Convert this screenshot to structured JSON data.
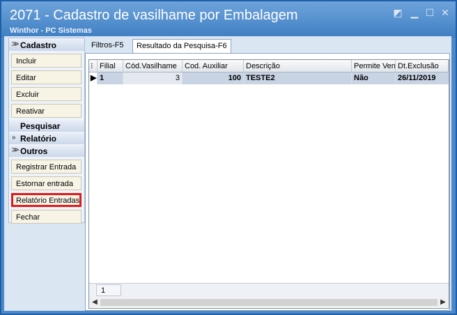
{
  "window": {
    "title": "2071 - Cadastro de vasilhame por Embalagem",
    "subtitle": "Winthor - PC Sistemas"
  },
  "sidebar": {
    "groups": [
      {
        "label": "Cadastro",
        "items": [
          "Incluir",
          "Editar",
          "Excluir",
          "Reativar"
        ]
      },
      {
        "label": "Pesquisar"
      },
      {
        "label": "Relatório"
      },
      {
        "label": "Outros",
        "items": [
          "Registrar Entrada",
          "Estornar entrada",
          "Relatório Entradas",
          "Fechar"
        ]
      }
    ]
  },
  "tabs": [
    "Filtros-F5",
    "Resultado da Pesquisa-F6"
  ],
  "grid": {
    "columns": [
      "Filial",
      "Cód.Vasilhame",
      "Cod. Auxiliar",
      "Descrição",
      "Permite Vend",
      "Dt.Exclusão"
    ],
    "rows": [
      [
        "1",
        "3",
        "100",
        "TESTE2",
        "Não",
        "26/11/2019"
      ]
    ],
    "footer_count": "1"
  },
  "colors": {
    "titlebar": "#4d88c8",
    "selected_row": "#c8d4e4",
    "highlight": "#e01b1b"
  }
}
